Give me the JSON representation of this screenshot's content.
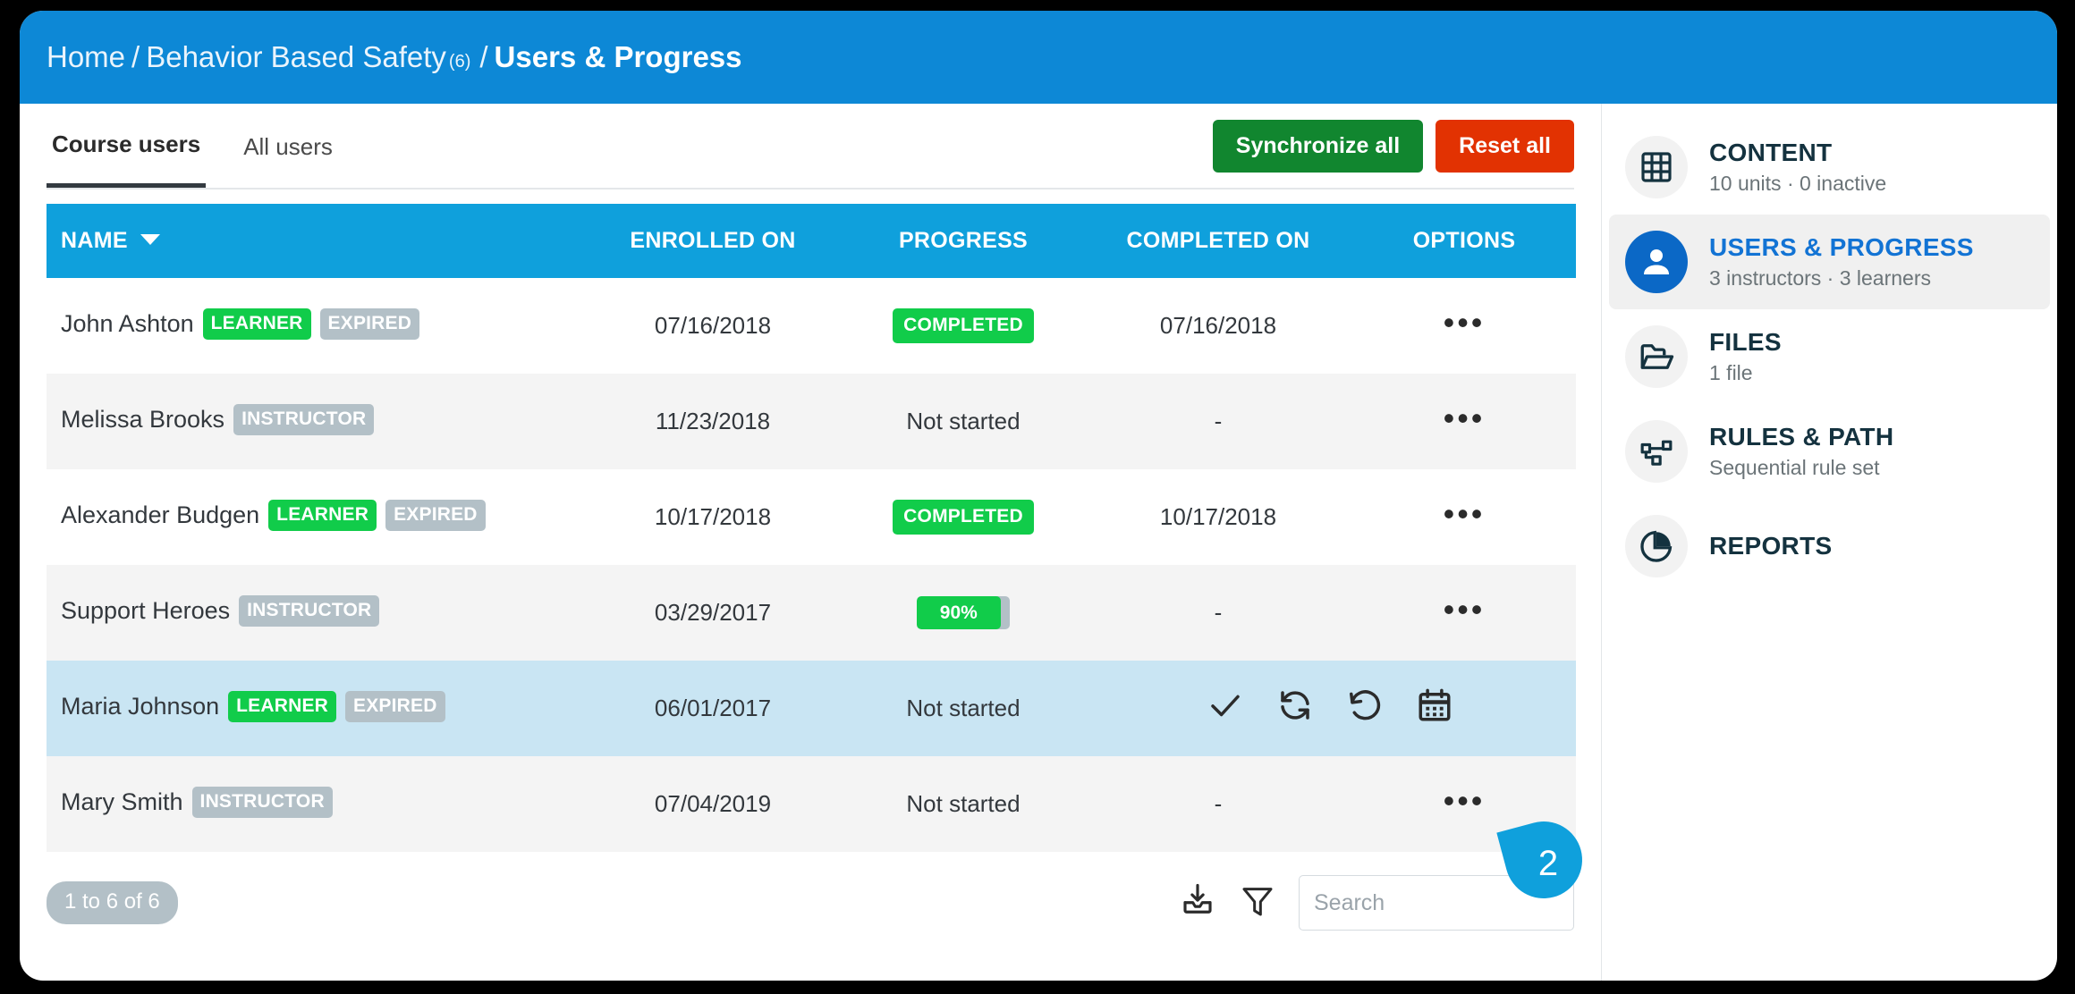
{
  "breadcrumb": {
    "home": "Home",
    "sep1": "/",
    "course": "Behavior Based Safety",
    "course_count": "(6)",
    "sep2": "/",
    "current": "Users & Progress"
  },
  "tabs": [
    {
      "label": "Course users",
      "active": true
    },
    {
      "label": "All users",
      "active": false
    }
  ],
  "toolbar": {
    "synchronize_label": "Synchronize all",
    "reset_label": "Reset all"
  },
  "table": {
    "columns": {
      "name": "NAME",
      "enrolled_on": "ENROLLED ON",
      "progress": "PROGRESS",
      "completed_on": "COMPLETED ON",
      "options": "OPTIONS"
    },
    "rows": [
      {
        "name": "John Ashton",
        "pills": [
          {
            "label": "LEARNER",
            "kind": "learner"
          },
          {
            "label": "EXPIRED",
            "kind": "expired"
          }
        ],
        "enrolled_on": "07/16/2018",
        "progress_type": "completed",
        "progress_label": "COMPLETED",
        "progress_value": 100,
        "completed_on": "07/16/2018",
        "options": "•••"
      },
      {
        "name": "Melissa Brooks",
        "pills": [
          {
            "label": "INSTRUCTOR",
            "kind": "instructor"
          }
        ],
        "enrolled_on": "11/23/2018",
        "progress_type": "text",
        "progress_label": "Not started",
        "progress_value": 0,
        "completed_on": "-",
        "options": "•••"
      },
      {
        "name": "Alexander Budgen",
        "pills": [
          {
            "label": "LEARNER",
            "kind": "learner"
          },
          {
            "label": "EXPIRED",
            "kind": "expired"
          }
        ],
        "enrolled_on": "10/17/2018",
        "progress_type": "completed",
        "progress_label": "COMPLETED",
        "progress_value": 100,
        "completed_on": "10/17/2018",
        "options": "•••"
      },
      {
        "name": "Support Heroes",
        "pills": [
          {
            "label": "INSTRUCTOR",
            "kind": "instructor"
          }
        ],
        "enrolled_on": "03/29/2017",
        "progress_type": "bar",
        "progress_label": "90%",
        "progress_value": 90,
        "completed_on": "-",
        "options": "•••"
      },
      {
        "name": "Maria Johnson",
        "pills": [
          {
            "label": "LEARNER",
            "kind": "learner"
          },
          {
            "label": "EXPIRED",
            "kind": "expired"
          }
        ],
        "enrolled_on": "06/01/2017",
        "progress_type": "text",
        "progress_label": "Not started",
        "progress_value": 0,
        "completed_on": "",
        "options": "actions",
        "selected": true,
        "actions": [
          "check-icon",
          "synchronize-icon",
          "reset-icon",
          "calendar-icon"
        ]
      },
      {
        "name": "Mary Smith",
        "pills": [
          {
            "label": "INSTRUCTOR",
            "kind": "instructor"
          }
        ],
        "enrolled_on": "07/04/2019",
        "progress_type": "text",
        "progress_label": "Not started",
        "progress_value": 0,
        "completed_on": "-",
        "options": "•••"
      }
    ]
  },
  "footer": {
    "count_label": "1 to 6 of 6",
    "search_placeholder": "Search",
    "export_icon": "download-export-icon",
    "filter_icon": "filter-funnel-icon"
  },
  "marker": {
    "number": "2"
  },
  "sidebar": {
    "items": [
      {
        "title": "CONTENT",
        "subtitle": "10 units · 0 inactive",
        "icon": "grid-icon",
        "active": false
      },
      {
        "title": "USERS & PROGRESS",
        "subtitle": "3 instructors · 3 learners",
        "icon": "user-icon",
        "active": true
      },
      {
        "title": "FILES",
        "subtitle": "1 file",
        "icon": "folder-open-icon",
        "active": false
      },
      {
        "title": "RULES & PATH",
        "subtitle": "Sequential rule set",
        "icon": "sitemap-icon",
        "active": false
      },
      {
        "title": "REPORTS",
        "subtitle": "",
        "icon": "pie-chart-icon",
        "active": false
      }
    ]
  },
  "colors": {
    "header_blue": "#0d88d6",
    "table_header_blue": "#0fa0dc",
    "green": "#11cc4a",
    "sync_green": "#11862f",
    "reset_red": "#e23202",
    "gray_pill": "#b3c0c7",
    "selected_row": "#c9e5f3",
    "accent_blue": "#1273d4"
  }
}
